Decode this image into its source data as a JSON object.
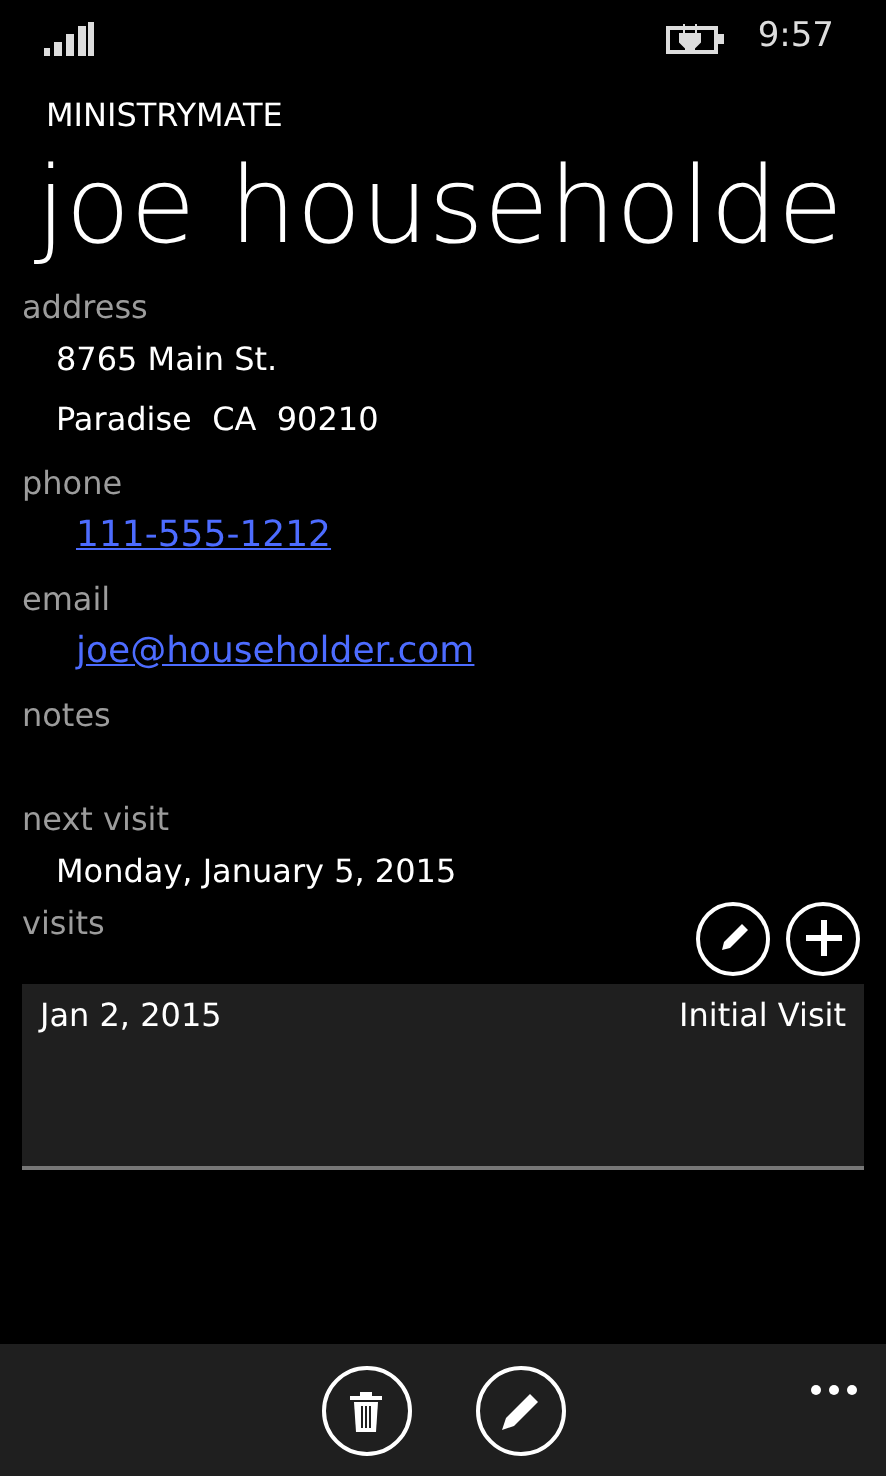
{
  "status_bar": {
    "time": "9:57"
  },
  "app_name": "MINISTRYMATE",
  "title": "joe householde",
  "fields": [
    {
      "label": "address",
      "kind": "text",
      "lines": [
        "8765 Main St.",
        "Paradise  CA  90210"
      ]
    },
    {
      "label": "phone",
      "kind": "link",
      "lines": [
        "111-555-1212"
      ]
    },
    {
      "label": "email",
      "kind": "link",
      "lines": [
        "joe@householder.com"
      ]
    },
    {
      "label": "notes"
    },
    {
      "label": "next visit",
      "kind": "text",
      "lines": [
        "Monday, January 5, 2015"
      ]
    }
  ],
  "visits": {
    "label": "visits",
    "rows": [
      {
        "date": "Jan 2, 2015",
        "type": "Initial Visit"
      }
    ]
  }
}
